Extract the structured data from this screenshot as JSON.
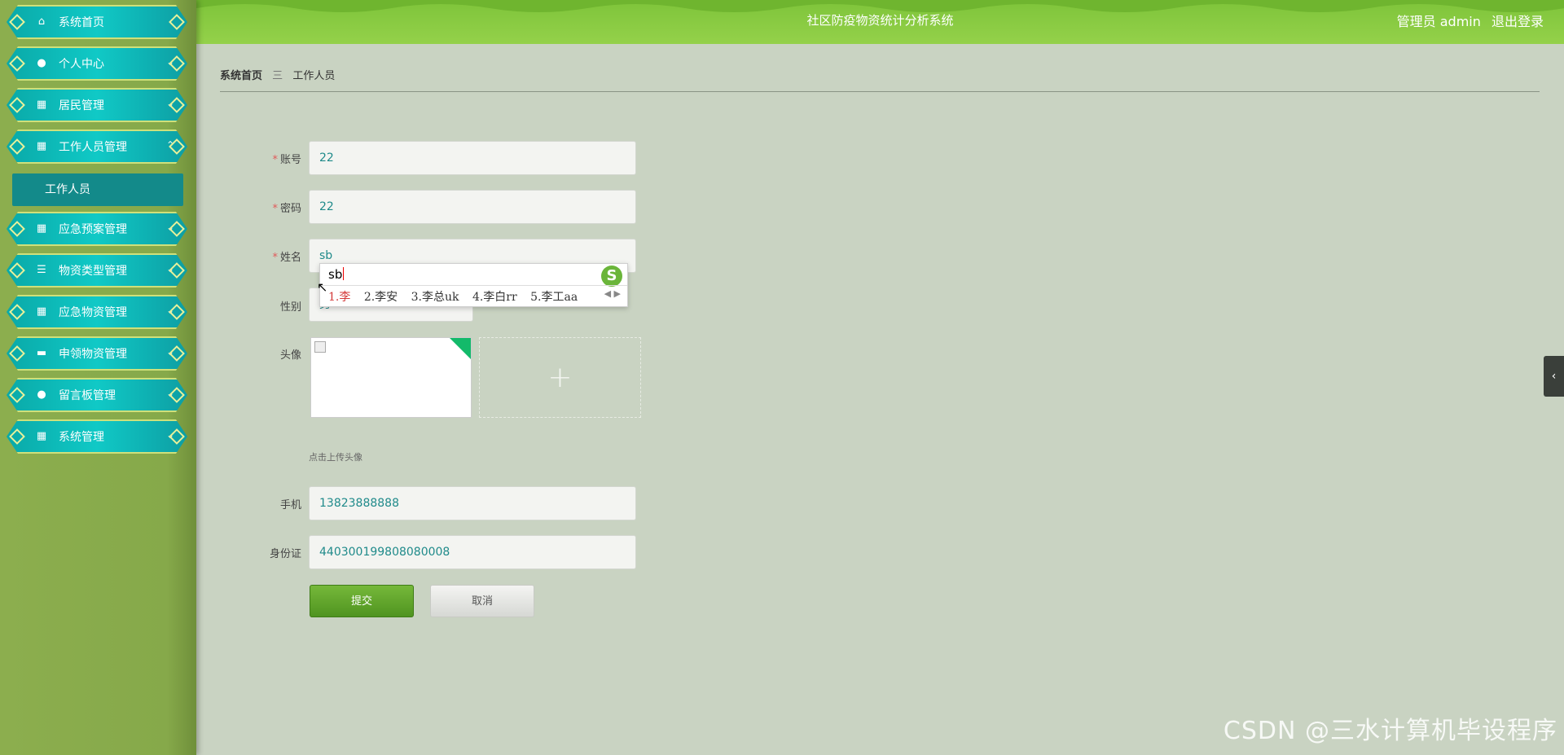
{
  "sidebar": {
    "items": [
      {
        "label": "系统首页",
        "icon": "home-icon",
        "glyph": "⌂",
        "chevron": ""
      },
      {
        "label": "个人中心",
        "icon": "user-icon",
        "glyph": "●",
        "chevron": "⌄"
      },
      {
        "label": "居民管理",
        "icon": "grid-icon",
        "glyph": "▦",
        "chevron": "⌄"
      },
      {
        "label": "工作人员管理",
        "icon": "grid-icon",
        "glyph": "▦",
        "chevron": "⌃"
      },
      {
        "label": "应急预案管理",
        "icon": "grid-icon",
        "glyph": "▦",
        "chevron": "⌄"
      },
      {
        "label": "物资类型管理",
        "icon": "sliders-icon",
        "glyph": "☰",
        "chevron": "⌄"
      },
      {
        "label": "应急物资管理",
        "icon": "grid-icon",
        "glyph": "▦",
        "chevron": "⌄"
      },
      {
        "label": "申领物资管理",
        "icon": "briefcase-icon",
        "glyph": "▬",
        "chevron": "⌄"
      },
      {
        "label": "留言板管理",
        "icon": "bulb-icon",
        "glyph": "●",
        "chevron": "⌄"
      },
      {
        "label": "系统管理",
        "icon": "grid-icon",
        "glyph": "▦",
        "chevron": "⌄"
      }
    ],
    "sub_item": "工作人员"
  },
  "header": {
    "title": "社区防疫物资统计分析系统",
    "user": "管理员 admin",
    "logout": "退出登录"
  },
  "breadcrumb": {
    "home": "系统首页",
    "sep": "三",
    "current": "工作人员"
  },
  "form": {
    "account_label": "账号",
    "account_value": "22",
    "password_label": "密码",
    "password_value": "22",
    "name_label": "姓名",
    "name_value": "sb",
    "gender_label": "性别",
    "gender_value": "男",
    "avatar_label": "头像",
    "avatar_hint": "点击上传头像",
    "upload_plus": "+",
    "phone_label": "手机",
    "phone_value": "13823888888",
    "idcard_label": "身份证",
    "idcard_value": "440300199808080008",
    "submit": "提交",
    "cancel": "取消",
    "required_mark": "*"
  },
  "ime": {
    "composition": "sb",
    "candidates": [
      "1.李",
      "2.李安",
      "3.李总uk",
      "4.李白rr",
      "5.李工aa"
    ],
    "logo": "S"
  },
  "side_toggle": "‹",
  "watermark": "CSDN @三水计算机毕设程序",
  "colors": {
    "header_green": "#7ec43a",
    "sidebar_green": "#8cae4e",
    "menu_teal": "#10c9c6",
    "submit_green": "#5fa52a"
  }
}
